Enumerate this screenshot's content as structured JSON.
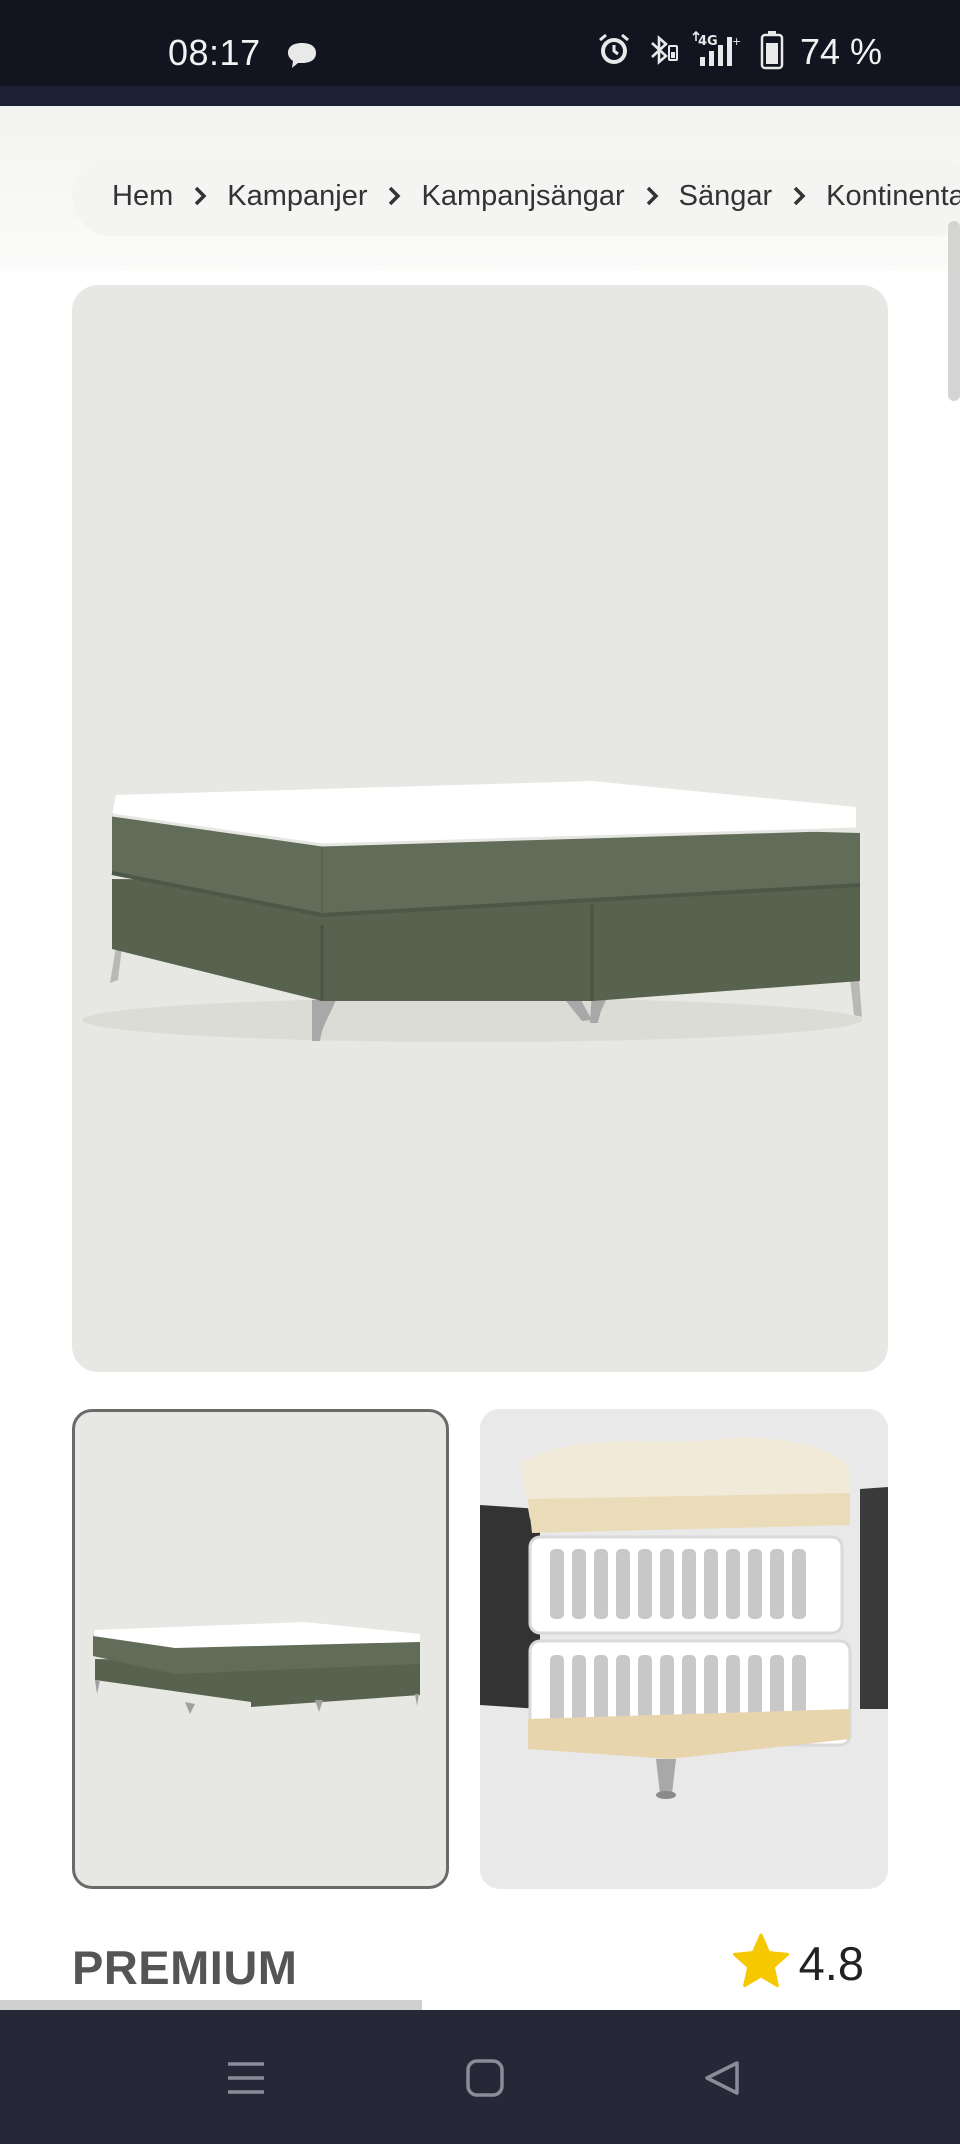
{
  "status_bar": {
    "time": "08:17",
    "battery": "74 %",
    "icons": [
      "chat-bubble-icon",
      "alarm-icon",
      "bluetooth-icon",
      "4g-signal-icon",
      "battery-icon"
    ]
  },
  "breadcrumb": {
    "items": [
      "Hem",
      "Kampanjer",
      "Kampanjsängar",
      "Sängar",
      "Kontinentalsängar"
    ]
  },
  "gallery": {
    "images": [
      "green-continental-bed",
      "green-continental-bed-thumbnail",
      "spring-layers-cross-section"
    ]
  },
  "product": {
    "label": "PREMIUM",
    "rating": "4.8"
  },
  "scroll_progress": 0.44,
  "colors": {
    "status_bg": "#12141f",
    "nav_bg": "#262838",
    "image_bg": "#e7e7e3",
    "bed_green": "#5e6b58",
    "star": "#f6c800"
  }
}
